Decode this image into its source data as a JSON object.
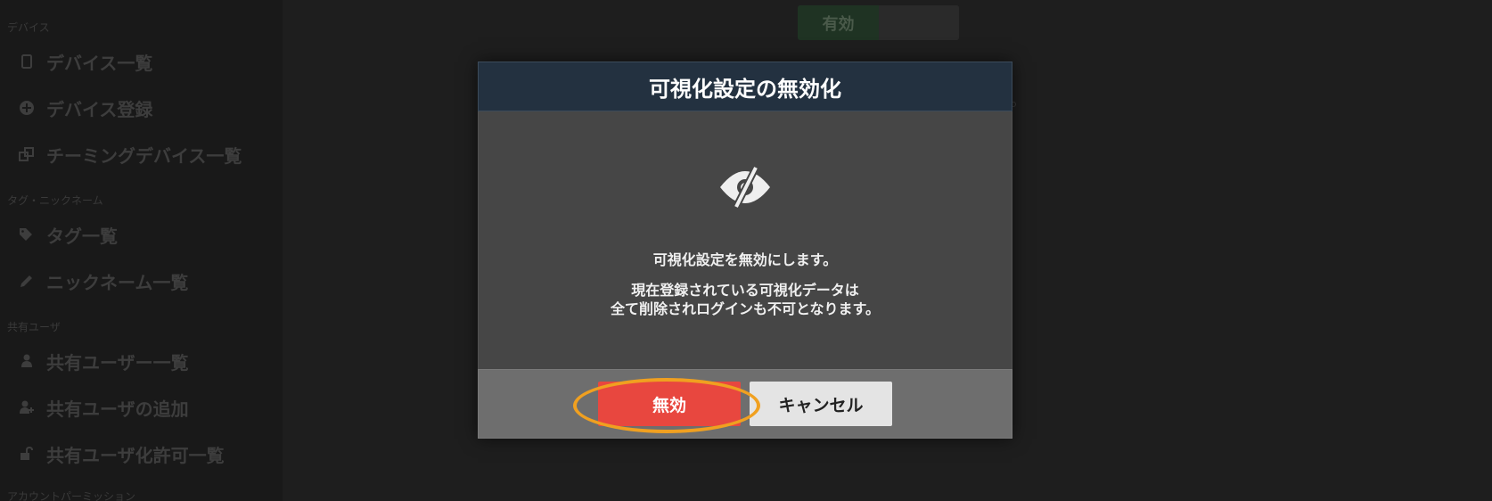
{
  "sidebar": {
    "sections": [
      {
        "label": "デバイス"
      },
      {
        "label": "タグ・ニックネーム"
      },
      {
        "label": "共有ユーザ"
      },
      {
        "label": "アカウントパーミッション"
      }
    ],
    "items": [
      {
        "label": "デバイス一覧",
        "icon": "tablet-icon"
      },
      {
        "label": "デバイス登録",
        "icon": "plus-circle-icon"
      },
      {
        "label": "チーミングデバイス一覧",
        "icon": "clone-icon"
      },
      {
        "label": "タグ一覧",
        "icon": "tags-icon"
      },
      {
        "label": "ニックネーム一覧",
        "icon": "pencil-icon"
      },
      {
        "label": "共有ユーザー一覧",
        "icon": "user-icon"
      },
      {
        "label": "共有ユーザの追加",
        "icon": "user-plus-icon"
      },
      {
        "label": "共有ユーザ化許可一覧",
        "icon": "unlock-icon"
      }
    ]
  },
  "toggle": {
    "on_label": "有効"
  },
  "modal": {
    "title": "可視化設定の無効化",
    "icon": "eye-slash-icon",
    "message_line1": "可視化設定を無効にします。",
    "message_line2a": "現在登録されている可視化データは",
    "message_line2b": "全て削除されログインも不可となります。",
    "disable_label": "無効",
    "cancel_label": "キャンセル"
  },
  "colors": {
    "header_bg": "#233140",
    "body_bg": "#464646",
    "footer_bg": "#6e6e6e",
    "danger": "#e8473f",
    "highlight": "#f0a020"
  }
}
